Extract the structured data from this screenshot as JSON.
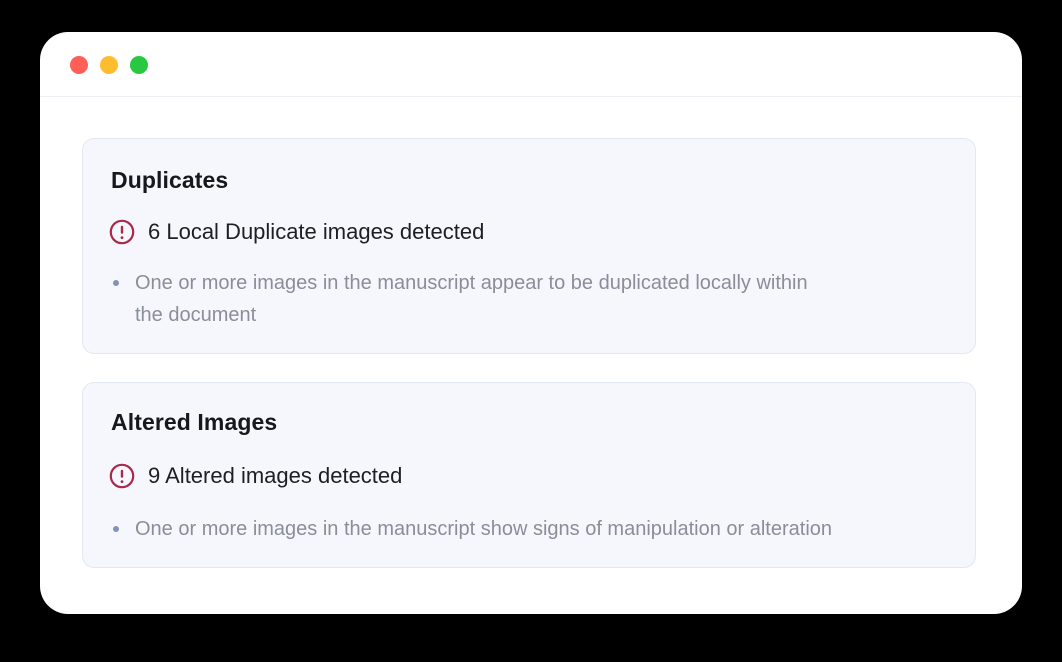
{
  "colors": {
    "alert_icon": "#a8294a",
    "card_background": "#f6f7fc",
    "card_border": "#e3e8f5",
    "bullet": "#8193b6",
    "window_controls": [
      "#ff5f57",
      "#febc2e",
      "#28c840"
    ]
  },
  "window_controls": {
    "close_icon": "circle-red",
    "minimize_icon": "circle-yellow",
    "maximize_icon": "circle-green"
  },
  "sections": [
    {
      "title": "Duplicates",
      "alert_icon": "exclamation-circle-icon",
      "alert_text": "6 Local Duplicate images detected",
      "bullets": [
        "One or more images in the manuscript appear to be duplicated locally within the document"
      ]
    },
    {
      "title": "Altered Images",
      "alert_icon": "exclamation-circle-icon",
      "alert_text": "9 Altered images detected",
      "bullets": [
        "One or more images in the manuscript show signs of manipulation or alteration"
      ]
    }
  ]
}
